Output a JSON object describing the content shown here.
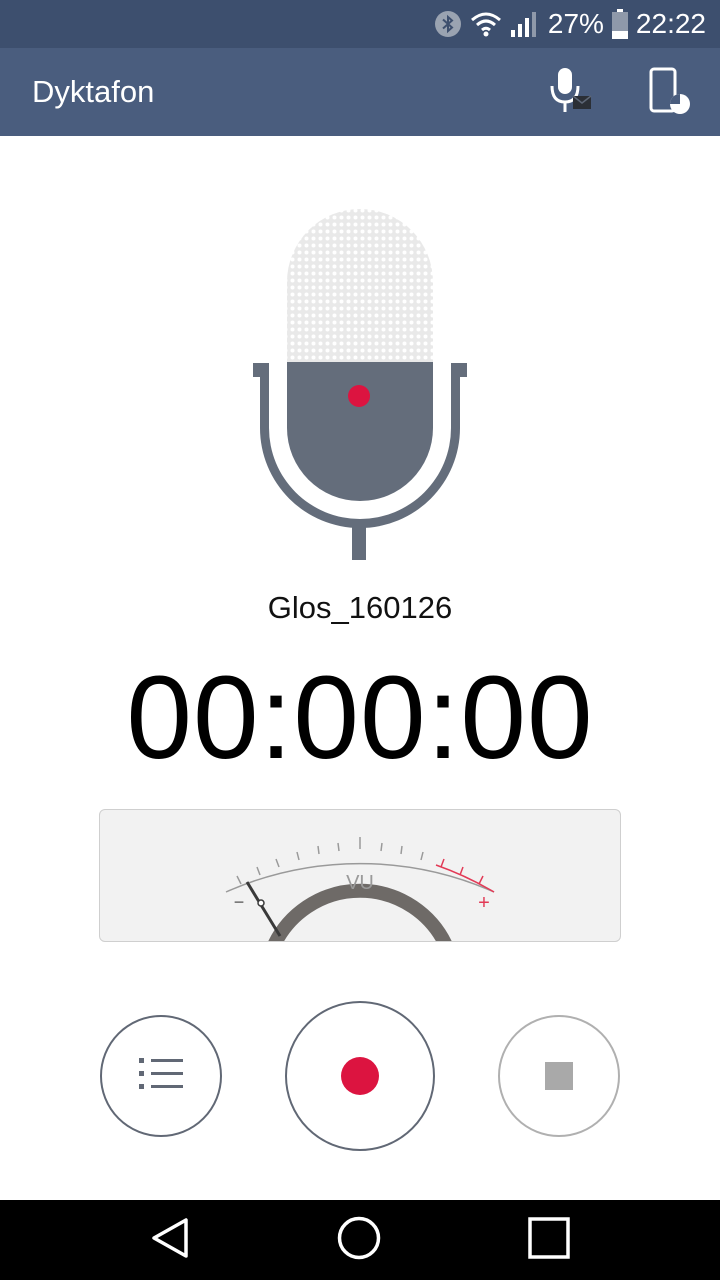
{
  "status_bar": {
    "battery_percent": "27%",
    "time": "22:22",
    "icons": [
      "bluetooth-icon",
      "wifi-icon",
      "signal-icon",
      "battery-icon"
    ]
  },
  "app_bar": {
    "title": "Dyktafon",
    "actions": [
      "mic-share-icon",
      "phone-settings-icon"
    ]
  },
  "recording": {
    "file_name": "Glos_160126",
    "elapsed": "00:00:00",
    "vu_label": "VU",
    "vu_minus": "−",
    "vu_plus": "+",
    "vu_level": 0
  },
  "controls": [
    "recordings-list-button",
    "record-button",
    "stop-button"
  ],
  "nav_bar": [
    "back-icon",
    "home-icon",
    "recents-icon"
  ],
  "colors": {
    "status_bar": "#3d4f6e",
    "app_bar": "#4a5d7e",
    "accent_red": "#dc1440",
    "mic_body": "#646d7b"
  }
}
